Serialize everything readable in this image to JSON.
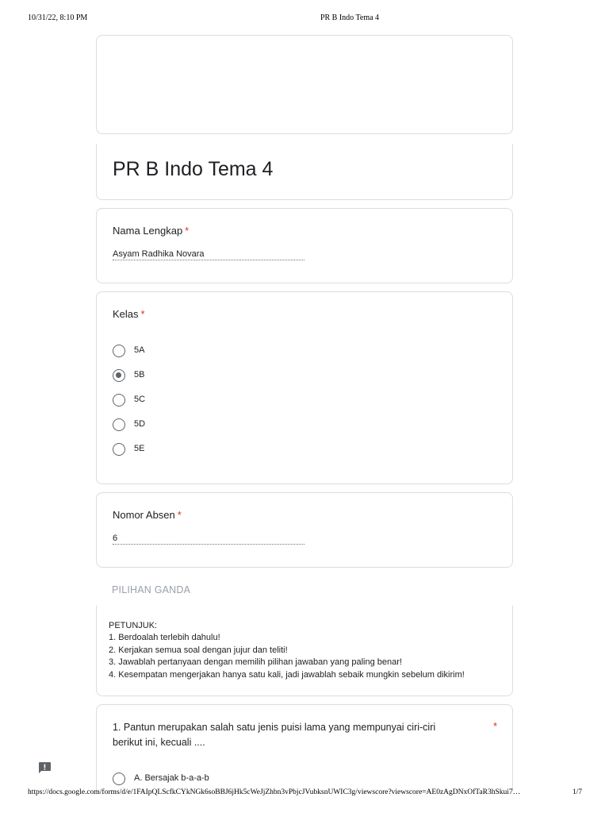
{
  "print_header": {
    "datetime": "10/31/22, 8:10 PM",
    "title": "PR B Indo Tema 4"
  },
  "print_footer": {
    "url": "https://docs.google.com/forms/d/e/1FAIpQLScfkCYkNGk6soBBJ6jHk5cWeJjZhbn3vPbjcJVubksnUWIC3g/viewscore?viewscore=AE0zAgDNxOfTaR3hSkui7…",
    "page": "1/7"
  },
  "form": {
    "title": "PR B Indo Tema 4"
  },
  "questions": {
    "nama": {
      "label": "Nama Lengkap",
      "required_mark": "*",
      "answer": "Asyam Radhika Novara"
    },
    "kelas": {
      "label": "Kelas",
      "required_mark": "*",
      "options": [
        "5A",
        "5B",
        "5C",
        "5D",
        "5E"
      ],
      "selected": "5B"
    },
    "absen": {
      "label": "Nomor Absen",
      "required_mark": "*",
      "answer": "6"
    }
  },
  "section": {
    "title": "PILIHAN GANDA",
    "instructions": {
      "heading": "PETUNJUK:",
      "lines": [
        "1. Berdoalah terlebih dahulu!",
        "2. Kerjakan semua soal dengan jujur dan teliti!",
        "3. Jawablah pertanyaan dengan memilih pilihan jawaban yang paling benar!",
        "4. Kesempatan mengerjakan hanya satu kali, jadi jawablah sebaik mungkin sebelum dikirim!"
      ]
    }
  },
  "q1": {
    "text": "1.   Pantun merupakan salah satu jenis puisi lama yang mempunyai ciri-ciri berikut ini, kecuali ....",
    "required_mark": "*",
    "options": [
      "A. Bersajak b-a-a-b"
    ]
  },
  "icons": {
    "feedback": "feedback-icon",
    "radio_unchecked": "radio-unchecked-icon",
    "radio_checked": "radio-checked-icon"
  },
  "colors": {
    "required": "#d93025",
    "border": "#dadce0",
    "section_header": "#9aa0a6",
    "radio": "#5f6368"
  }
}
